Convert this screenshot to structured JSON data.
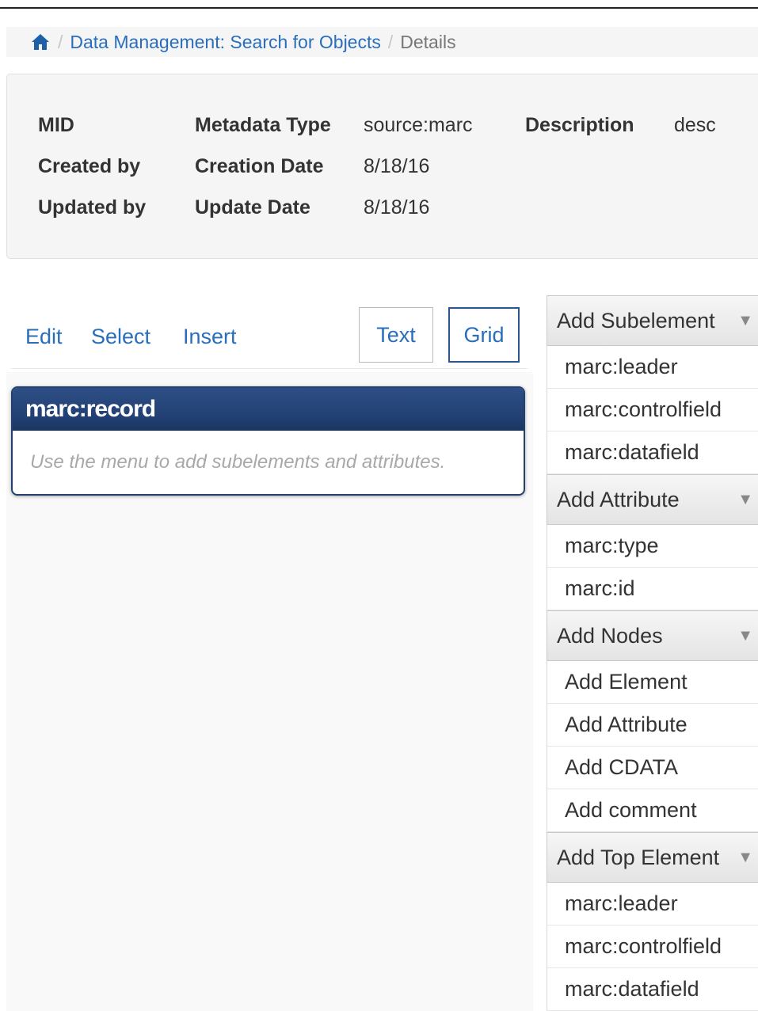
{
  "breadcrumb": {
    "home_icon": "home-icon",
    "separator": "/",
    "link": "Data Management: Search for Objects",
    "current": "Details"
  },
  "details": {
    "mid_label": "MID",
    "created_by_label": "Created by",
    "updated_by_label": "Updated by",
    "metadata_type_label": "Metadata Type",
    "metadata_type_value": "source:marc",
    "creation_date_label": "Creation Date",
    "creation_date_value": "8/18/16",
    "update_date_label": "Update Date",
    "update_date_value": "8/18/16",
    "description_label": "Description",
    "description_value": "desc"
  },
  "toolbar": {
    "edit": "Edit",
    "select": "Select",
    "insert": "Insert",
    "text_view": "Text",
    "grid_view": "Grid"
  },
  "editor": {
    "record_title": "marc:record",
    "hint": "Use the menu to add subelements and attributes."
  },
  "side_menu": {
    "collapse_icon": "triangle-down-icon",
    "add_subelement": {
      "title": "Add Subelement",
      "items": [
        "marc:leader",
        "marc:controlfield",
        "marc:datafield"
      ]
    },
    "add_attribute": {
      "title": "Add Attribute",
      "items": [
        "marc:type",
        "marc:id"
      ]
    },
    "add_nodes": {
      "title": "Add Nodes",
      "items": [
        "Add Element",
        "Add Attribute",
        "Add CDATA",
        "Add comment"
      ]
    },
    "add_top_element": {
      "title": "Add Top Element",
      "items": [
        "marc:leader",
        "marc:controlfield",
        "marc:datafield"
      ]
    }
  }
}
